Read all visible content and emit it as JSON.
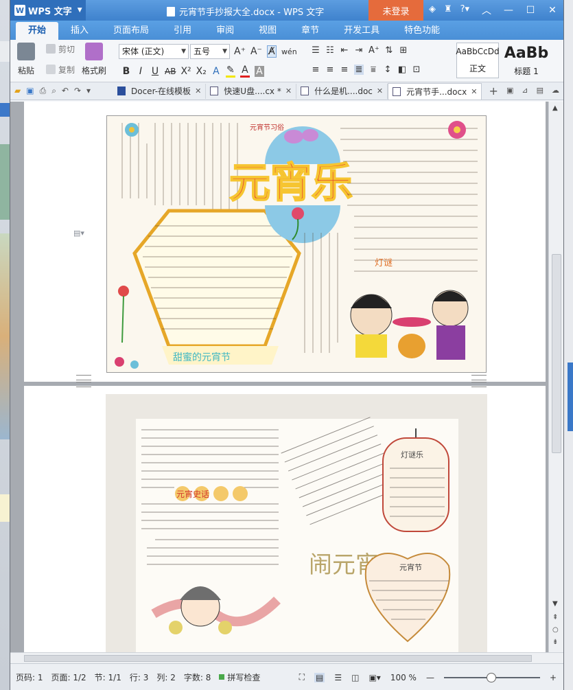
{
  "app": {
    "name": "WPS 文字",
    "document_title": "元宵节手抄报大全.docx - WPS 文字",
    "login_label": "未登录"
  },
  "tabs": [
    "开始",
    "插入",
    "页面布局",
    "引用",
    "审阅",
    "视图",
    "章节",
    "开发工具",
    "特色功能"
  ],
  "ribbon": {
    "paste": "粘贴",
    "cut": "剪切",
    "copy": "复制",
    "format_painter": "格式刷",
    "font_name": "宋体 (正文)",
    "font_size": "五号",
    "style_normal_sample": "AaBbCcDd",
    "style_normal_label": "正文",
    "style_h1_sample": "AaBb",
    "style_h1_label": "标题 1"
  },
  "doc_tabs": [
    {
      "label": "Docer-在线模板",
      "active": false
    },
    {
      "label": "快速U盘....cx *",
      "active": false
    },
    {
      "label": "什么是机....doc",
      "active": false
    },
    {
      "label": "元宵节手...docx",
      "active": true
    }
  ],
  "poster1": {
    "title": "元宵乐",
    "corner_text": "元宵节习俗",
    "banner": "甜蜜的元宵节",
    "riddle_label": "灯谜"
  },
  "poster2": {
    "title": "闹元宵",
    "lantern_label": "灯谜乐",
    "history_label": "元宵史话",
    "heart_label": "元宵节"
  },
  "status": {
    "page_num": "页码: 1",
    "pages": "页面: 1/2",
    "section": "节: 1/1",
    "row": "行: 3",
    "col": "列: 2",
    "word_count": "字数: 8",
    "spell_check": "拼写检查",
    "zoom": "100 %"
  },
  "colors": {
    "title_bar": "#4a8fd6",
    "login": "#e56b3c",
    "accent": "#3a78c8"
  }
}
